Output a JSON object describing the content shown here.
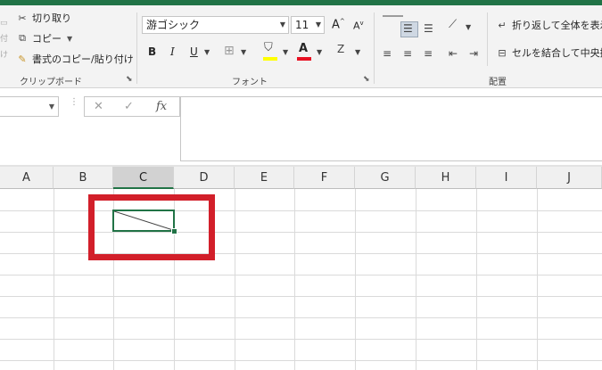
{
  "ribbon": {
    "clipboard": {
      "cut_label": "切り取り",
      "copy_label": "コピー",
      "format_painter_label": "書式のコピー/貼り付け",
      "group_label": "クリップボード",
      "paste_fragment": "付け"
    },
    "font": {
      "font_name": "游ゴシック",
      "font_size": "11",
      "bold": "B",
      "italic": "I",
      "underline": "U",
      "font_color_letter": "A",
      "increase_size_letter": "A",
      "decrease_size_letter": "A",
      "group_label": "フォント"
    },
    "alignment": {
      "wrap_text_label": "折り返して全体を表示",
      "merge_center_label": "セルを結合して中央揃",
      "group_label": "配置"
    },
    "colors": {
      "highlight": "#ffff00",
      "font_color": "#e81123",
      "accent": "#217346"
    }
  },
  "formula_bar": {
    "fx_label": "fx",
    "cancel_symbol": "✕",
    "enter_symbol": "✓",
    "formula_value": ""
  },
  "grid": {
    "columns": [
      "A",
      "B",
      "C",
      "D",
      "E",
      "F",
      "G",
      "H",
      "I",
      "J"
    ],
    "selected_column": "C"
  },
  "annotation": {
    "color": "#d21f2a"
  }
}
